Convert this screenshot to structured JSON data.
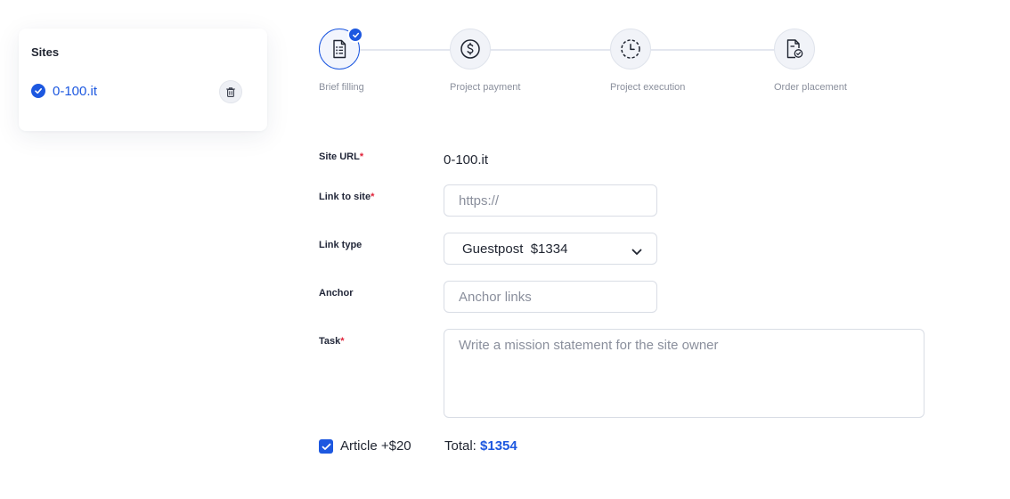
{
  "sites": {
    "title": "Sites",
    "items": [
      {
        "name": "0-100.it",
        "checked": true
      }
    ]
  },
  "stepper": {
    "steps": [
      {
        "label": "Brief filling",
        "icon": "document-list-icon",
        "active": true,
        "completed": true
      },
      {
        "label": "Project payment",
        "icon": "dollar-coin-icon",
        "active": false,
        "completed": false
      },
      {
        "label": "Project execution",
        "icon": "clock-icon",
        "active": false,
        "completed": false
      },
      {
        "label": "Order placement",
        "icon": "document-check-icon",
        "active": false,
        "completed": false
      }
    ]
  },
  "form": {
    "site_url": {
      "label": "Site URL",
      "required": "*",
      "value": "0-100.it"
    },
    "link_to_site": {
      "label": "Link to site",
      "required": "*",
      "placeholder": "https://",
      "value": ""
    },
    "link_type": {
      "label": "Link type",
      "value": "Guestpost  $1334"
    },
    "anchor": {
      "label": "Anchor",
      "placeholder": "Anchor links",
      "value": ""
    },
    "task": {
      "label": "Task",
      "required": "*",
      "placeholder": "Write a mission statement for the site owner",
      "value": ""
    }
  },
  "article": {
    "label": "Article +$20",
    "checked": true
  },
  "total": {
    "label": "Total:",
    "amount": "$1354"
  },
  "colors": {
    "accent": "#1d58e0",
    "required": "#e0243a",
    "muted": "#8a8f9c"
  }
}
